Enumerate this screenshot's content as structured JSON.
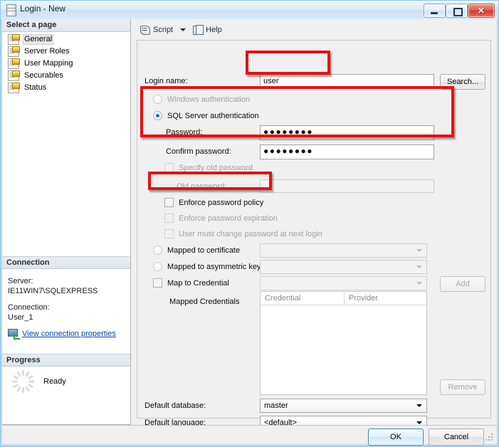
{
  "window": {
    "title": "Login - New",
    "icon": "server-icon",
    "controls": {
      "minimize": "—",
      "maximize": "□",
      "close": "✕"
    }
  },
  "toolbar": {
    "script_label": "Script",
    "script_icon": "script-icon",
    "dropdown_icon": "chevron-down-icon",
    "help_label": "Help",
    "help_icon": "help-icon"
  },
  "sidebar": {
    "select_page_header": "Select a page",
    "pages": [
      {
        "label": "General",
        "selected": true
      },
      {
        "label": "Server Roles",
        "selected": false
      },
      {
        "label": "User Mapping",
        "selected": false
      },
      {
        "label": "Securables",
        "selected": false
      },
      {
        "label": "Status",
        "selected": false
      }
    ],
    "connection_header": "Connection",
    "server_label": "Server:",
    "server_value": "IE11WIN7\\SQLEXPRESS",
    "connection_label": "Connection:",
    "connection_value": "User_1",
    "view_properties_link": "View connection properties",
    "view_properties_icon": "connection-properties-icon",
    "progress_header": "Progress",
    "progress_status": "Ready",
    "progress_icon": "spinner-icon"
  },
  "main": {
    "login_name_label": "Login name:",
    "login_name_value": "user",
    "search_button": "Search...",
    "windows_auth_label": "Windows authentication",
    "windows_auth_selected": false,
    "sql_auth_label": "SQL Server authentication",
    "sql_auth_selected": true,
    "password_label": "Password:",
    "password_value": "●●●●●●●●",
    "confirm_password_label": "Confirm password:",
    "confirm_password_value": "●●●●●●●●",
    "specify_old_password_label": "Specify old password",
    "specify_old_password_checked": false,
    "old_password_label": "Old password:",
    "old_password_value": "",
    "enforce_policy_label": "Enforce password policy",
    "enforce_policy_checked": false,
    "enforce_expiration_label": "Enforce password expiration",
    "enforce_expiration_checked": false,
    "must_change_label": "User must change password at next login",
    "must_change_checked": false,
    "mapped_certificate_label": "Mapped to certificate",
    "mapped_certificate_value": "",
    "mapped_asymmetric_label": "Mapped to asymmetric key",
    "mapped_asymmetric_value": "",
    "map_credential_label": "Map to Credential",
    "map_credential_value": "",
    "add_button": "Add",
    "mapped_credentials_label": "Mapped Credentials",
    "credentials_columns": [
      "Credential",
      "Provider"
    ],
    "credentials_rows": [],
    "remove_button": "Remove",
    "default_database_label": "Default database:",
    "default_database_value": "master",
    "default_language_label": "Default language:",
    "default_language_value": "<default>"
  },
  "footer": {
    "ok_button": "OK",
    "cancel_button": "Cancel"
  },
  "annotations": {
    "color": "#e8100f",
    "boxes": [
      {
        "name": "login-name-highlight"
      },
      {
        "name": "sql-auth-highlight"
      },
      {
        "name": "enforce-policy-highlight"
      }
    ]
  }
}
